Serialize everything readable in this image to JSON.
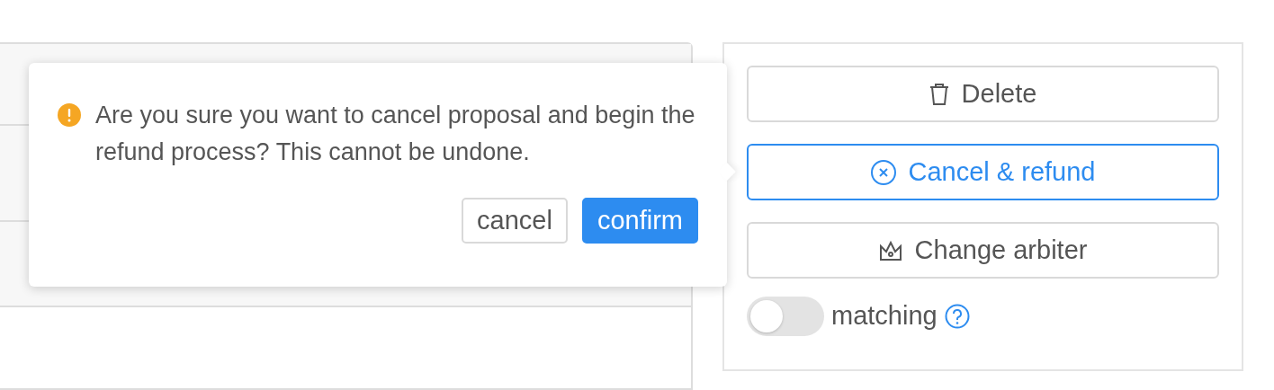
{
  "background_panel": {
    "rows": [
      {
        "kind": "row"
      },
      {
        "kind": "row"
      },
      {
        "kind": "row"
      }
    ]
  },
  "popover": {
    "message": "Are you sure you want to cancel proposal and begin the refund process? This cannot be undone.",
    "buttons": [
      {
        "label": "cancel",
        "kind": "default"
      },
      {
        "label": "confirm",
        "kind": "primary"
      }
    ]
  },
  "actions": [
    {
      "label": "Delete",
      "selected": false
    },
    {
      "label": "Cancel & refund",
      "selected": true
    },
    {
      "label": "Change arbiter",
      "selected": false
    }
  ],
  "matching": {
    "label": "matching",
    "on": false
  }
}
